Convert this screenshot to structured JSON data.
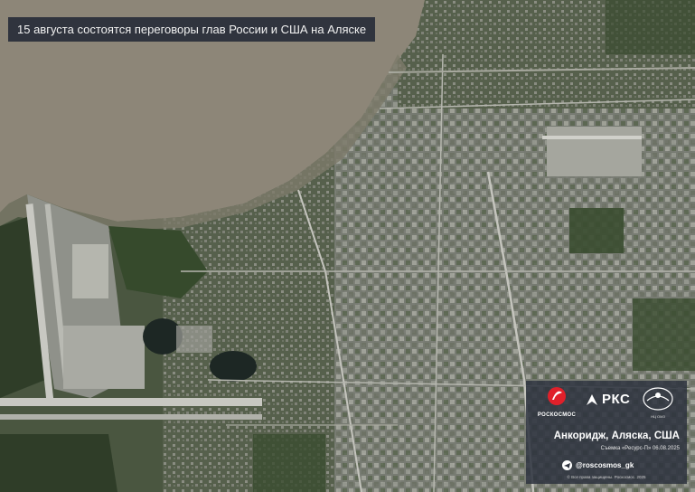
{
  "headline": "15 августа состоятся переговоры глав России и США на Аляске",
  "panel": {
    "roscosmos_logo_text": "РОСКОСМОС",
    "rks_logo_text": "РКС",
    "ntz_logo_text": "НЦ ОМЗ",
    "place": "Анкоридж, Аляска, США",
    "capture": "Съемка «Ресурс-П» 06.08.2025",
    "social_handle": "@roscosmos_gk",
    "rights": "© Все права защищены. Роскосмос. 2025"
  },
  "colors": {
    "water": "#8d8678",
    "land_dark": "#3d4a34",
    "urban": "#8a8c84",
    "panel": "#2d323e"
  },
  "icons": [
    "roscosmos-logo-icon",
    "rks-logo-icon",
    "ntz-logo-icon",
    "telegram-icon"
  ]
}
